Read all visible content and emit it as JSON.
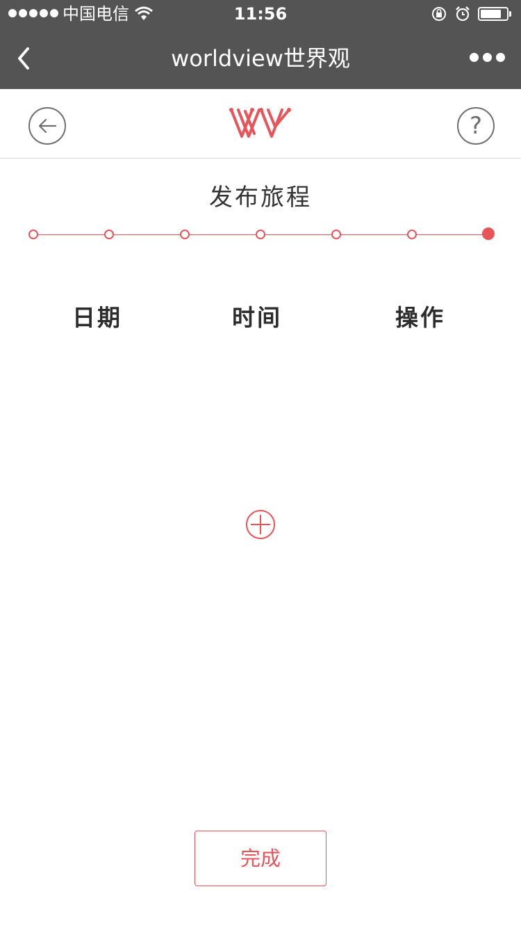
{
  "status_bar": {
    "carrier": "中国电信",
    "time": "11:56",
    "signal_dots": 5,
    "battery_level": 0.8
  },
  "nav_bar": {
    "title": "worldview世界观",
    "back_icon": "chevron-left-icon",
    "more_icon": "more-dots-icon"
  },
  "header": {
    "back_icon": "arrow-left-circle-icon",
    "help_glyph": "?",
    "logo": "worldview-logo-icon"
  },
  "page": {
    "title": "发布旅程",
    "steps_total": 7,
    "current_step": 7
  },
  "table": {
    "columns": [
      "日期",
      "时间",
      "操作"
    ],
    "rows": []
  },
  "add_icon": "plus-circle-icon",
  "footer": {
    "done_label": "完成"
  },
  "colors": {
    "bar_background": "#545454",
    "accent": "#e8545a",
    "text_dark": "#2c2c2c",
    "icon_gray": "#6e6e6e",
    "divider": "#d9d9d9"
  }
}
